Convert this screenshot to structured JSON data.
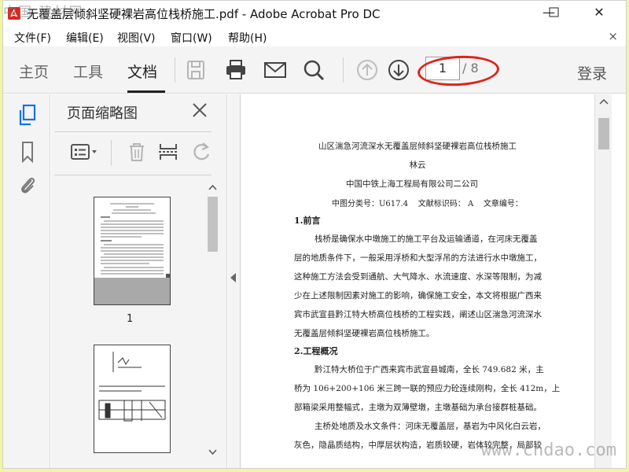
{
  "window": {
    "title": "无覆盖层倾斜坚硬裸岩高位栈桥施工.pdf - Adobe Acrobat Pro DC",
    "minimize": "—",
    "maximize": "☐",
    "close": "✕"
  },
  "watermarks": {
    "top_left": "中国 建材网",
    "bottom_right": "www.cndao.com"
  },
  "menu": {
    "items": [
      {
        "label": "文件(F)"
      },
      {
        "label": "编辑(E)"
      },
      {
        "label": "视图(V)"
      },
      {
        "label": "窗口(W)"
      },
      {
        "label": "帮助(H)"
      }
    ],
    "close": "×"
  },
  "toolbar": {
    "tabs": [
      {
        "label": "主页"
      },
      {
        "label": "工具"
      },
      {
        "label": "文档"
      }
    ],
    "icons": [
      "save-icon",
      "print-icon",
      "mail-icon",
      "search-icon",
      "page-up-icon",
      "page-down-icon"
    ],
    "current_page": "1",
    "total_pages": "/ 8",
    "login": "登录"
  },
  "sidebar": {
    "icons": [
      "page-thumbnails-icon",
      "bookmark-icon",
      "attachment-icon"
    ]
  },
  "thumbnails": {
    "title": "页面缩略图",
    "page1_label": "1"
  },
  "document": {
    "title": "山区湍急河流深水无覆盖层倾斜坚硬裸岩高位栈桥施工",
    "author": "林云",
    "org": "中国中铁上海工程局有限公司二公司",
    "classification": "中图分类号：U617.4    文献标识码： A    文章编号：",
    "section1": "1.前言",
    "para1": [
      "栈桥是确保水中墩施工的施工平台及运输通道，在河床无覆盖",
      "层的地质条件下，一般采用浮桥和大型浮吊的方法进行水中墩施工，",
      "这种施工方法会受到通航、大气降水、水流速度、水深等限制，为减",
      "少在上述限制因素对施工的影响，确保施工安全，本文将根据广西来",
      "宾市武宣县黔江特大桥高位栈桥的工程实践，阐述山区湍急河流深水",
      "无覆盖层倾斜坚硬裸岩高位栈桥施工。"
    ],
    "section2": "2.工程概况",
    "para2": [
      "黔江特大桥位于广西来宾市武宣县城南，全长 749.682 米，主",
      "桥为 106+200+106 米三跨一联的预应力砼连续刚构，全长 412m，上",
      "部箱梁采用整幅式，主墩为双薄壁墩，主墩基础为承台接群桩基础。",
      "主桥处地质及水文条件：河床无覆盖层，基岩为中风化白云岩，",
      "灰色，隐晶质结构，中厚层状构造，岩质较硬，岩体较完整，局部较"
    ]
  }
}
